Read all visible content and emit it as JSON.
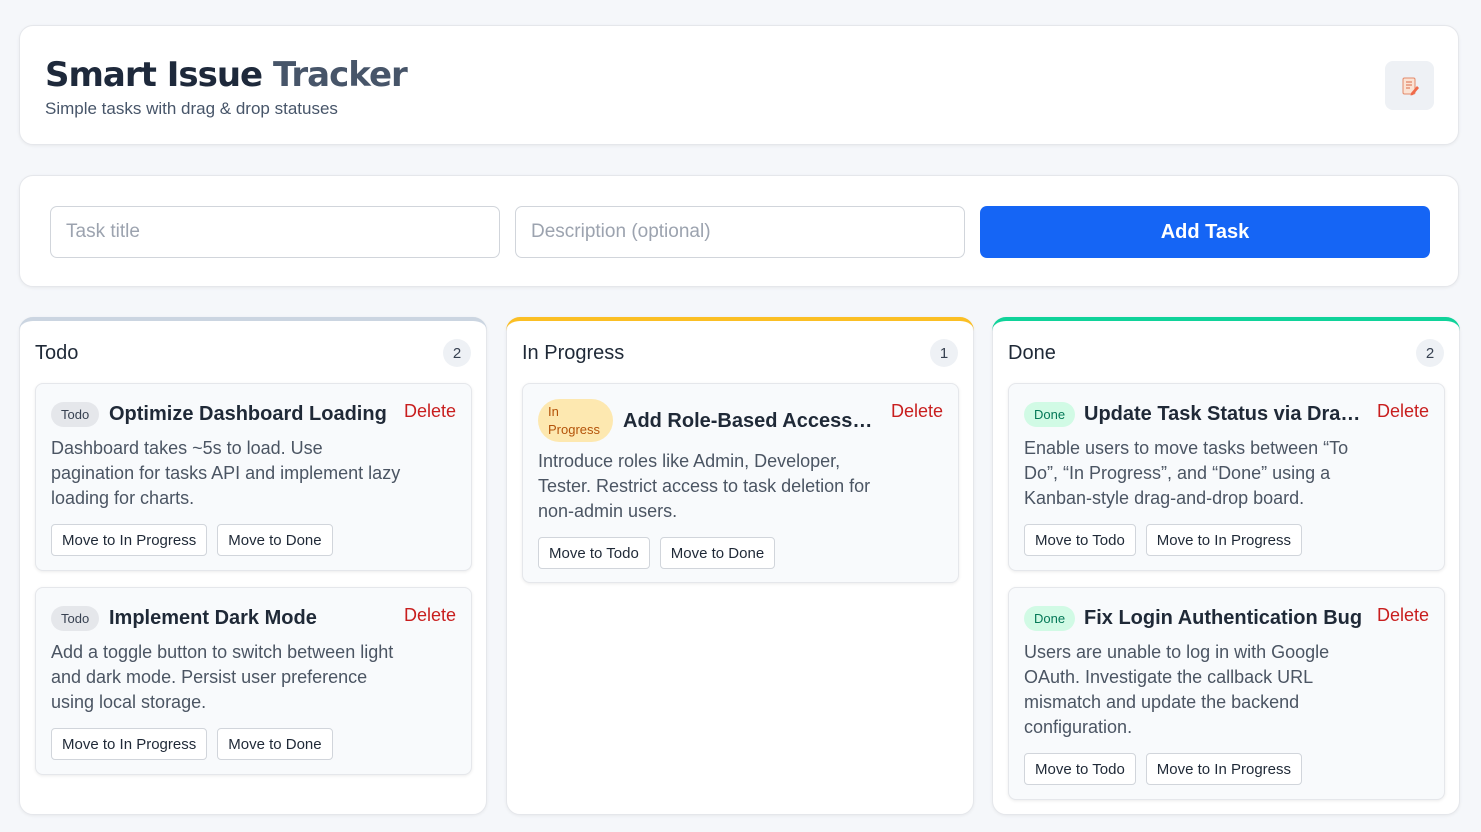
{
  "header": {
    "title_part1": "Smart Issue ",
    "title_part2": "Tracker",
    "subtitle": "Simple tasks with drag & drop statuses",
    "icon": "memo-icon"
  },
  "form": {
    "title_placeholder": "Task title",
    "desc_placeholder": "Description (optional)",
    "add_label": "Add Task"
  },
  "columns": [
    {
      "name": "Todo",
      "count": "2",
      "accent": "#cbd5e1",
      "cards": [
        {
          "badge": "Todo",
          "title": "Optimize Dashboard Loading",
          "delete": "Delete",
          "desc": "Dashboard takes ~5s to load. Use pagination for tasks API and implement lazy loading for charts.",
          "actions": [
            "Move to In Progress",
            "Move to Done"
          ]
        },
        {
          "badge": "Todo",
          "title": "Implement Dark Mode",
          "delete": "Delete",
          "desc": "Add a toggle button to switch between light and dark mode. Persist user preference using local storage.",
          "actions": [
            "Move to In Progress",
            "Move to Done"
          ]
        }
      ]
    },
    {
      "name": "In Progress",
      "count": "1",
      "accent": "#fbbf24",
      "cards": [
        {
          "badge": "In Progress",
          "title": "Add Role-Based Access C...",
          "delete": "Delete",
          "desc": "Introduce roles like Admin, Developer, Tester. Restrict access to task deletion for non-admin users.",
          "actions": [
            "Move to Todo",
            "Move to Done"
          ]
        }
      ]
    },
    {
      "name": "Done",
      "count": "2",
      "accent": "#10d39a",
      "cards": [
        {
          "badge": "Done",
          "title": "Update Task Status via Drag ...",
          "delete": "Delete",
          "desc": "Enable users to move tasks between “To Do”, “In Progress”, and “Done” using a Kanban-style drag-and-drop board.",
          "actions": [
            "Move to Todo",
            "Move to In Progress"
          ]
        },
        {
          "badge": "Done",
          "title": "Fix Login Authentication Bug",
          "delete": "Delete",
          "desc": "Users are unable to log in with Google OAuth. Investigate the callback URL mismatch and update the backend configuration.",
          "actions": [
            "Move to Todo",
            "Move to In Progress"
          ]
        }
      ]
    }
  ]
}
